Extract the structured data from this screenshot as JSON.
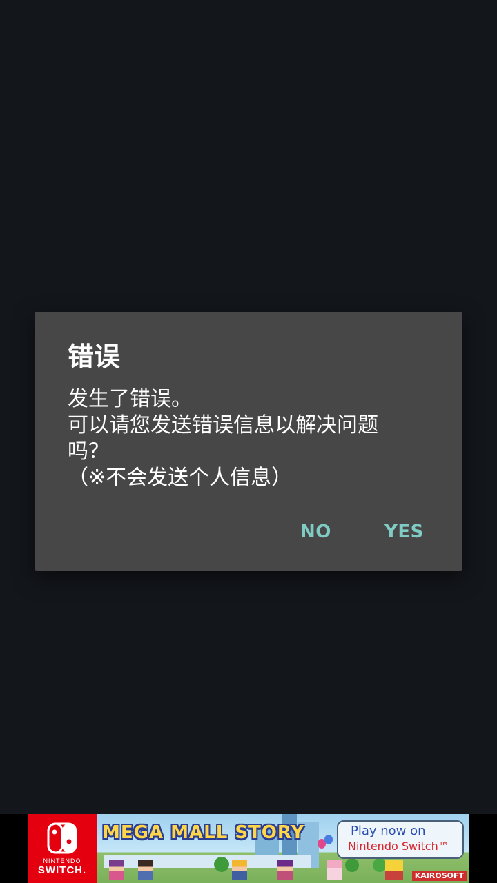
{
  "dialog": {
    "title": "错误",
    "message_lines": [
      "发生了错误。",
      "可以请您发送错误信息以解决问题",
      "吗？",
      "（※不会发送个人信息）"
    ],
    "no_label": "NO",
    "yes_label": "YES"
  },
  "ad": {
    "brand_small": "NINTENDO",
    "brand_big": "SWITCH.",
    "game_title": "MEGA MALL STORY",
    "cta_line1": "Play now on",
    "cta_line2": "Nintendo Switch™",
    "publisher": "KAIROSOFT"
  },
  "colors": {
    "background": "#13161b",
    "dialog": "#474747",
    "accent": "#80cbc4",
    "nintendo_red": "#e4000f"
  }
}
